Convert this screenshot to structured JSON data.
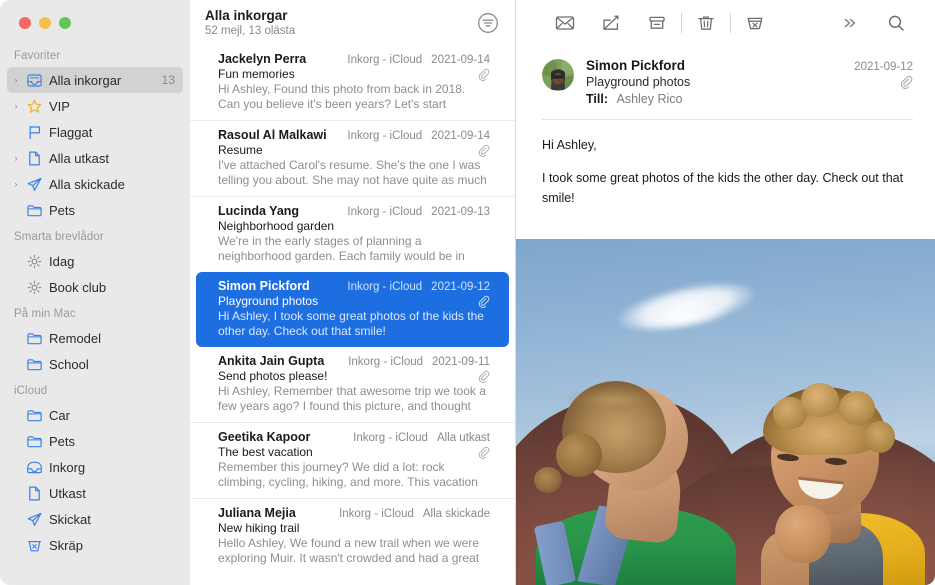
{
  "window": {
    "traffic_lights": [
      "close",
      "minimize",
      "zoom"
    ],
    "accent_blue": "#1d6ee0",
    "sidebar_bg": "#e9e9e9",
    "icon_blue": "#3b82e6"
  },
  "sidebar": {
    "sections": [
      {
        "title": "Favoriter",
        "items": [
          {
            "label": "Alla inkorgar",
            "icon": "inbox-tray-icon",
            "chevron": true,
            "selected": true,
            "count": "13"
          },
          {
            "label": "VIP",
            "icon": "star-icon",
            "chevron": true,
            "selected": false,
            "count": ""
          },
          {
            "label": "Flaggat",
            "icon": "flag-icon",
            "chevron": false,
            "selected": false,
            "count": ""
          },
          {
            "label": "Alla utkast",
            "icon": "document-icon",
            "chevron": true,
            "selected": false,
            "count": ""
          },
          {
            "label": "Alla skickade",
            "icon": "paper-plane-icon",
            "chevron": true,
            "selected": false,
            "count": ""
          },
          {
            "label": "Pets",
            "icon": "folder-icon",
            "chevron": false,
            "selected": false,
            "count": ""
          }
        ]
      },
      {
        "title": "Smarta brevlådor",
        "items": [
          {
            "label": "Idag",
            "icon": "gear-icon",
            "chevron": false,
            "selected": false,
            "count": ""
          },
          {
            "label": "Book club",
            "icon": "gear-icon",
            "chevron": false,
            "selected": false,
            "count": ""
          }
        ]
      },
      {
        "title": "På min Mac",
        "items": [
          {
            "label": "Remodel",
            "icon": "folder-icon",
            "chevron": false,
            "selected": false,
            "count": ""
          },
          {
            "label": "School",
            "icon": "folder-icon",
            "chevron": false,
            "selected": false,
            "count": ""
          }
        ]
      },
      {
        "title": "iCloud",
        "items": [
          {
            "label": "Car",
            "icon": "folder-icon",
            "chevron": false,
            "selected": false,
            "count": ""
          },
          {
            "label": "Pets",
            "icon": "folder-icon",
            "chevron": false,
            "selected": false,
            "count": ""
          },
          {
            "label": "Inkorg",
            "icon": "inbox-icon",
            "chevron": false,
            "selected": false,
            "count": ""
          },
          {
            "label": "Utkast",
            "icon": "document-icon",
            "chevron": false,
            "selected": false,
            "count": ""
          },
          {
            "label": "Skickat",
            "icon": "paper-plane-icon",
            "chevron": false,
            "selected": false,
            "count": ""
          },
          {
            "label": "Skräp",
            "icon": "junk-trash-icon",
            "chevron": false,
            "selected": false,
            "count": ""
          }
        ]
      }
    ]
  },
  "message_list": {
    "title": "Alla inkorgar",
    "subtitle": "52 mejl, 13 olästa",
    "filter_icon": "filter-icon",
    "messages": [
      {
        "from": "Jackelyn Perra",
        "mailbox": "Inkorg - iCloud",
        "date": "2021-09-14",
        "subject": "Fun memories",
        "preview": "Hi Ashley, Found this photo from back in 2018. Can you believe it's been years? Let's start planning our next a…",
        "attachment": true,
        "selected": false
      },
      {
        "from": "Rasoul Al Malkawi",
        "mailbox": "Inkorg - iCloud",
        "date": "2021-09-14",
        "subject": "Resume",
        "preview": "I've attached Carol's resume. She's the one I was telling you about. She may not have quite as much experienc…",
        "attachment": true,
        "selected": false
      },
      {
        "from": "Lucinda Yang",
        "mailbox": "Inkorg - iCloud",
        "date": "2021-09-13",
        "subject": "Neighborhood garden",
        "preview": "We're in the early stages of planning a neighborhood garden. Each family would be in charge of a plot. Bring…",
        "attachment": false,
        "selected": false
      },
      {
        "from": "Simon Pickford",
        "mailbox": "Inkorg - iCloud",
        "date": "2021-09-12",
        "subject": "Playground photos",
        "preview": "Hi Ashley, I took some great photos of the kids the other day. Check out that smile!",
        "attachment": true,
        "selected": true
      },
      {
        "from": "Ankita Jain Gupta",
        "mailbox": "Inkorg - iCloud",
        "date": "2021-09-11",
        "subject": "Send photos please!",
        "preview": "Hi Ashley, Remember that awesome trip we took a few years ago? I found this picture, and thought about all y…",
        "attachment": true,
        "selected": false
      },
      {
        "from": "Geetika Kapoor",
        "mailbox": "Inkorg - iCloud",
        "date": "Alla utkast",
        "subject": "The best vacation",
        "preview": "Remember this journey? We did a lot: rock climbing, cycling, hiking, and more. This vacation was amazing.…",
        "attachment": true,
        "selected": false
      },
      {
        "from": "Juliana Mejia",
        "mailbox": "Inkorg - iCloud",
        "date": "Alla skickade",
        "subject": "New hiking trail",
        "preview": "Hello Ashley, We found a new trail when we were exploring Muir. It wasn't crowded and had a great view.…",
        "attachment": false,
        "selected": false
      }
    ]
  },
  "toolbar": {
    "buttons": [
      {
        "name": "mark-unread-button",
        "icon": "envelope-icon"
      },
      {
        "name": "compose-button",
        "icon": "compose-icon"
      },
      {
        "name": "archive-button",
        "icon": "archive-icon"
      },
      {
        "name": "delete-button",
        "icon": "trash-icon"
      },
      {
        "name": "junk-button",
        "icon": "junk-icon"
      },
      {
        "name": "more-button",
        "icon": "chevrons-right-icon"
      },
      {
        "name": "search-button",
        "icon": "search-icon"
      }
    ]
  },
  "reader": {
    "sender": "Simon Pickford",
    "subject": "Playground photos",
    "to_label": "Till:",
    "to_value": "Ashley Rico",
    "date": "2021-09-12",
    "attachment": true,
    "avatar": "sender-avatar",
    "body_lines": [
      "Hi Ashley,",
      "I took some great photos of the kids the other day. Check out that smile!"
    ],
    "attachment_image": "playground-photo-two-children"
  }
}
